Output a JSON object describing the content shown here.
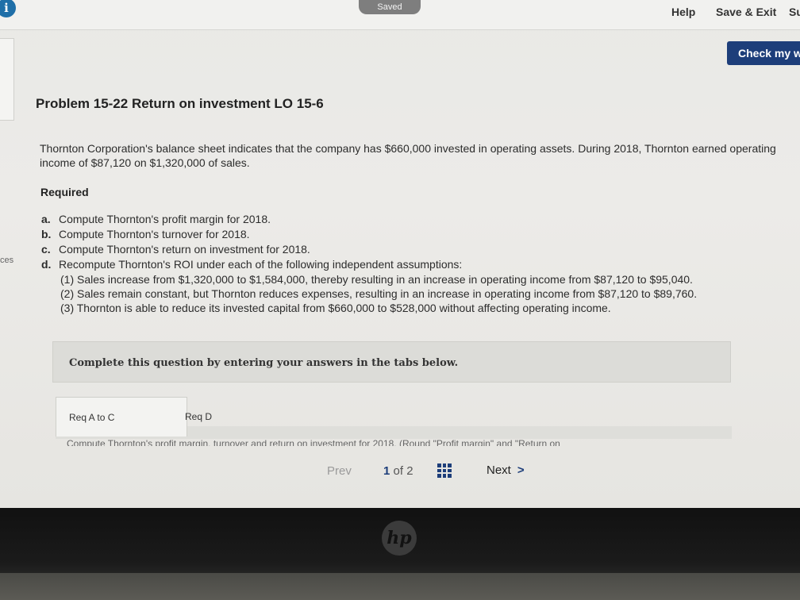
{
  "topbar": {
    "saved_label": "Saved",
    "help_label": "Help",
    "save_exit_label": "Save & Exit",
    "submit_cut_label": "Su",
    "check_label": "Check my w"
  },
  "left_cut_label": "ces",
  "problem": {
    "title": "Problem 15-22 Return on investment LO 15-6",
    "intro": "Thornton Corporation's balance sheet indicates that the company has $660,000 invested in operating assets. During 2018, Thornton earned operating income of $87,120 on $1,320,000 of sales.",
    "required_label": "Required",
    "requirements": [
      {
        "letter": "a.",
        "text": "Compute Thornton's profit margin for 2018."
      },
      {
        "letter": "b.",
        "text": "Compute Thornton's turnover for 2018."
      },
      {
        "letter": "c.",
        "text": "Compute Thornton's return on investment for 2018."
      },
      {
        "letter": "d.",
        "text": "Recompute Thornton's ROI under each of the following independent assumptions:"
      }
    ],
    "assumptions": [
      "(1) Sales increase from $1,320,000 to $1,584,000, thereby resulting in an increase in operating income from $87,120 to $95,040.",
      "(2) Sales remain constant, but Thornton reduces expenses, resulting in an increase in operating income from $87,120 to $89,760.",
      "(3) Thornton is able to reduce its invested capital from $660,000 to $528,000 without affecting operating income."
    ]
  },
  "question_panel": {
    "text": "Complete this question by entering your answers in the tabs below."
  },
  "tabs": [
    {
      "label": "Req A to C"
    },
    {
      "label": "Req D"
    }
  ],
  "instruction_cut": "Compute Thornton's profit margin, turnover and return on investment for 2018. (Round \"Profit margin\" and \"Return on",
  "pagination": {
    "prev_label": "Prev",
    "current_page": "1",
    "of_total": "of 2",
    "next_label": "Next",
    "next_chevron": ">"
  },
  "monitor": {
    "brand": "hp"
  }
}
